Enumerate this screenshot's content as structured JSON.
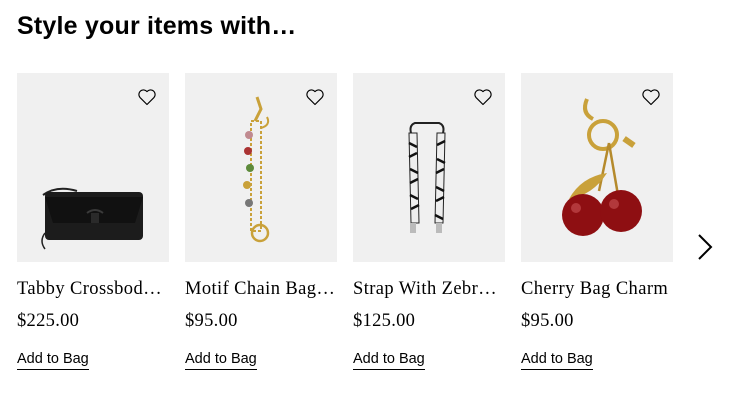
{
  "section": {
    "title": "Style your items with…"
  },
  "products": [
    {
      "name": "Tabby Crossbody Bag",
      "price": "$225.00",
      "add_label": "Add to Bag",
      "icon": "black-crossbody-bag"
    },
    {
      "name": "Motif Chain Bag Charm",
      "price": "$95.00",
      "add_label": "Add to Bag",
      "icon": "gold-charm-chain"
    },
    {
      "name": "Strap With Zebra Print",
      "price": "$125.00",
      "add_label": "Add to Bag",
      "icon": "zebra-strap"
    },
    {
      "name": "Cherry Bag Charm",
      "price": "$95.00",
      "add_label": "Add to Bag",
      "icon": "cherry-charm"
    }
  ],
  "colors": {
    "image_bg": "#f0f0f0",
    "text": "#000000",
    "gold": "#c9a13a",
    "cherry": "#8e0f12"
  },
  "icons": {
    "wishlist": "heart-outline-icon",
    "next": "chevron-right-icon"
  }
}
